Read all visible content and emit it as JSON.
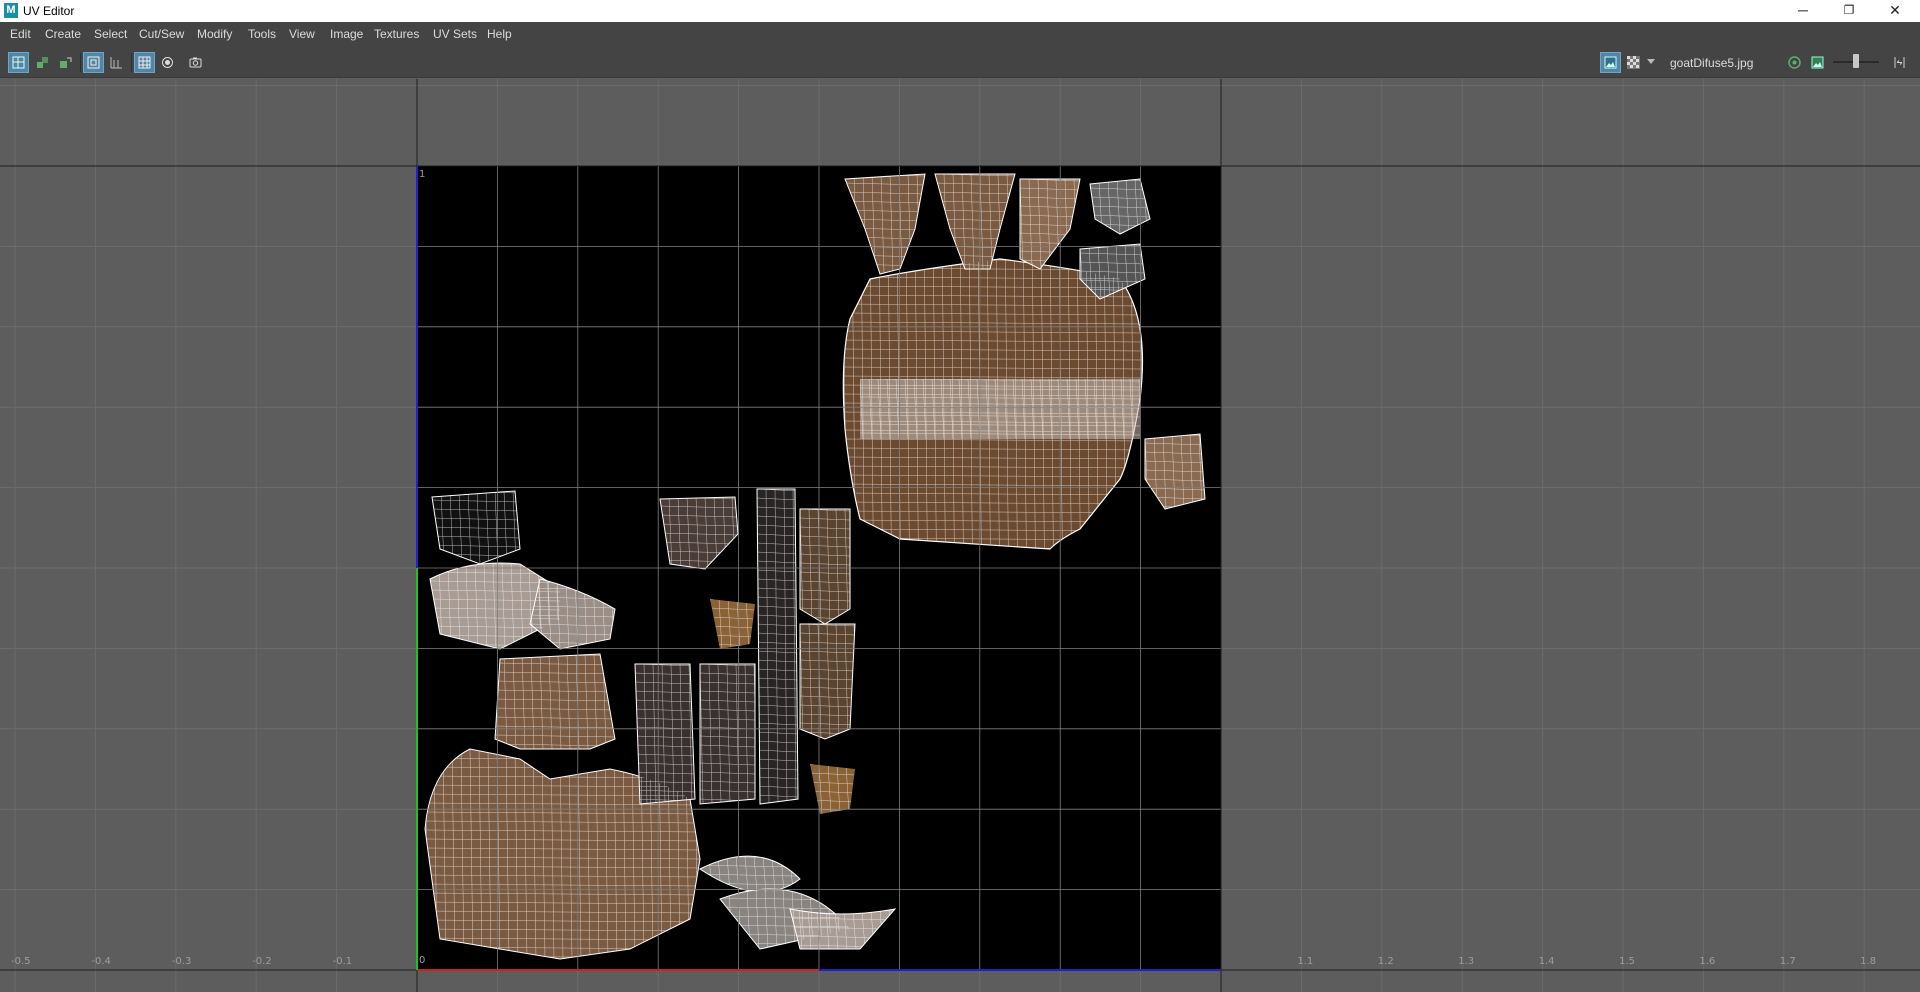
{
  "window": {
    "title": "UV Editor",
    "app_logo": "M",
    "controls": {
      "minimize": "─",
      "restore": "❐",
      "close": "✕"
    }
  },
  "menu": [
    "Edit",
    "Create",
    "Select",
    "Cut/Sew",
    "Modify",
    "Tools",
    "View",
    "Image",
    "Textures",
    "UV Sets",
    "Help"
  ],
  "toolbar": {
    "left_icons": [
      "uv-shell-select-icon",
      "uv-component-icon",
      "uv-move-icon",
      "wireframe-toggle-icon",
      "grid-icon",
      "isolate-icon",
      "xray-icon",
      "snapshot-icon"
    ],
    "texture_name": "goatDifuse5.jpg",
    "right_icons": [
      "image-display-icon",
      "checker-icon",
      "dropdown-arrow-icon",
      "exposure-icon",
      "color-managed-icon",
      "slider-icon",
      "range-icon"
    ],
    "slider_value": 0.5
  },
  "viewport": {
    "uv_range": [
      0,
      1
    ],
    "grid_divisions": 10,
    "grid_color": "#808080",
    "x_tick_labels": [
      "-0.5",
      "-0.4",
      "-0.3",
      "-0.2",
      "-0.1",
      "1.1",
      "1.2",
      "1.3",
      "1.4",
      "1.5",
      "1.6",
      "1.7",
      "1.8"
    ],
    "origin_label": "0",
    "top_label": "1",
    "axis_colors": {
      "u": "#d02020",
      "v": "#20c020",
      "border": "#2020d0"
    }
  }
}
